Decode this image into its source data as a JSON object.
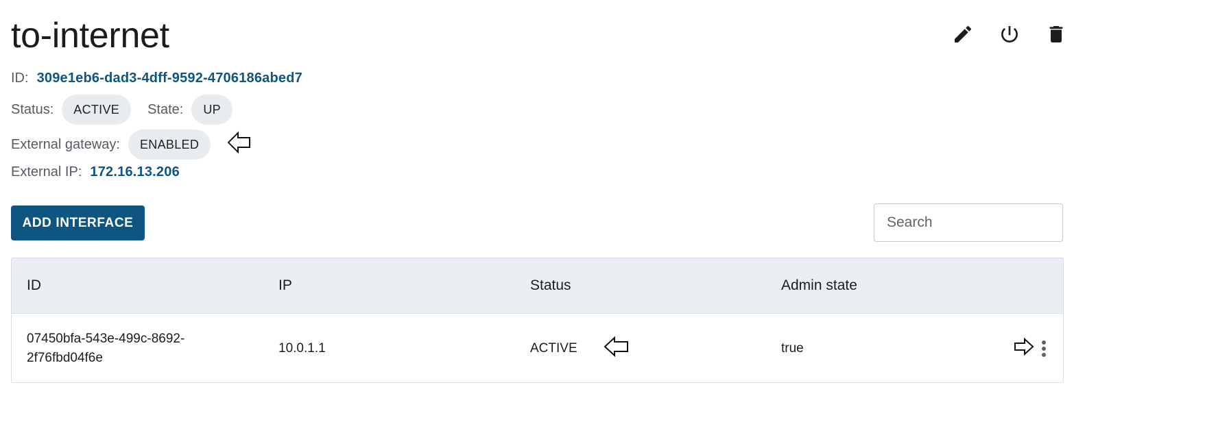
{
  "header": {
    "title": "to-internet"
  },
  "toolbar": {
    "edit_icon": "pencil-icon",
    "power_icon": "power-icon",
    "delete_icon": "trash-icon"
  },
  "details": {
    "id_label": "ID:",
    "id_value": "309e1eb6-dad3-4dff-9592-4706186abed7",
    "status_label": "Status:",
    "status_value": "ACTIVE",
    "state_label": "State:",
    "state_value": "UP",
    "gateway_label": "External gateway:",
    "gateway_value": "ENABLED",
    "external_ip_label": "External IP:",
    "external_ip_value": "172.16.13.206"
  },
  "actions": {
    "add_interface_label": "ADD INTERFACE",
    "search_placeholder": "Search"
  },
  "table": {
    "columns": [
      "ID",
      "IP",
      "Status",
      "Admin state"
    ],
    "rows": [
      {
        "id_line1": "07450bfa-543e-499c-8692-",
        "id_line2": "2f76fbd04f6e",
        "ip": "10.0.1.1",
        "status": "ACTIVE",
        "admin_state": "true"
      }
    ]
  },
  "colors": {
    "accent": "#0f5582",
    "chip_bg": "#e8ecf0",
    "header_bg": "#ebeff3"
  }
}
